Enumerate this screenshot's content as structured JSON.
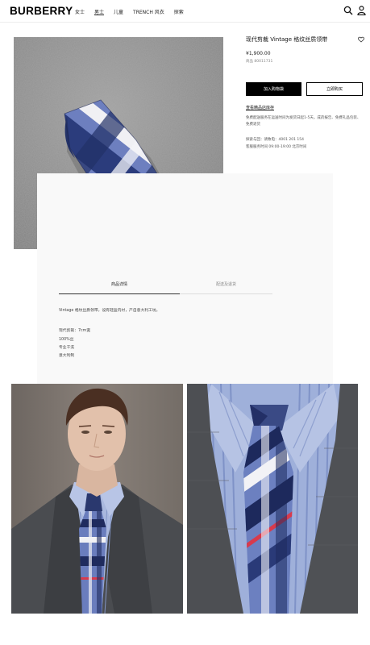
{
  "brand": "BURBERRY",
  "nav": {
    "items": [
      "女士",
      "男士",
      "儿童",
      "TRENCH 风衣",
      "探索"
    ],
    "active_index": 1
  },
  "icons": [
    "search-icon",
    "account-icon",
    "heart-icon"
  ],
  "product": {
    "title": "现代剪裁 Vintage 格纹丝质领带",
    "price": "¥1,900.00",
    "item_number": "商品 80011731",
    "add_to_cart": "加入购物袋",
    "buy_now": "立即购买",
    "stock_link": "查看精品店库存",
    "shipping_note": "免费配送服务在运送时间为发货日起1-5天。成药报告、免费礼品包装、免费退货",
    "service_phone": "探索与回：请致电：4001 201 154",
    "service_hours": "客服服务时间 09:00-19:00 北京时间"
  },
  "details": {
    "tabs": [
      "商品详情",
      "配送及退货"
    ],
    "description": "Vintage 格纹丝质领带，设有轻盈内衬，产自意大利工坊。",
    "specs": [
      "现代剪裁：7cm宽",
      "100%丝",
      "专业干洗",
      "意大利制"
    ]
  },
  "colors": {
    "tie_navy": "#283a78",
    "tie_blue": "#6e82c0",
    "tie_red": "#d83a4c",
    "suit_grey": "#4d4f53",
    "shirt_blue": "#a7b6dc"
  }
}
